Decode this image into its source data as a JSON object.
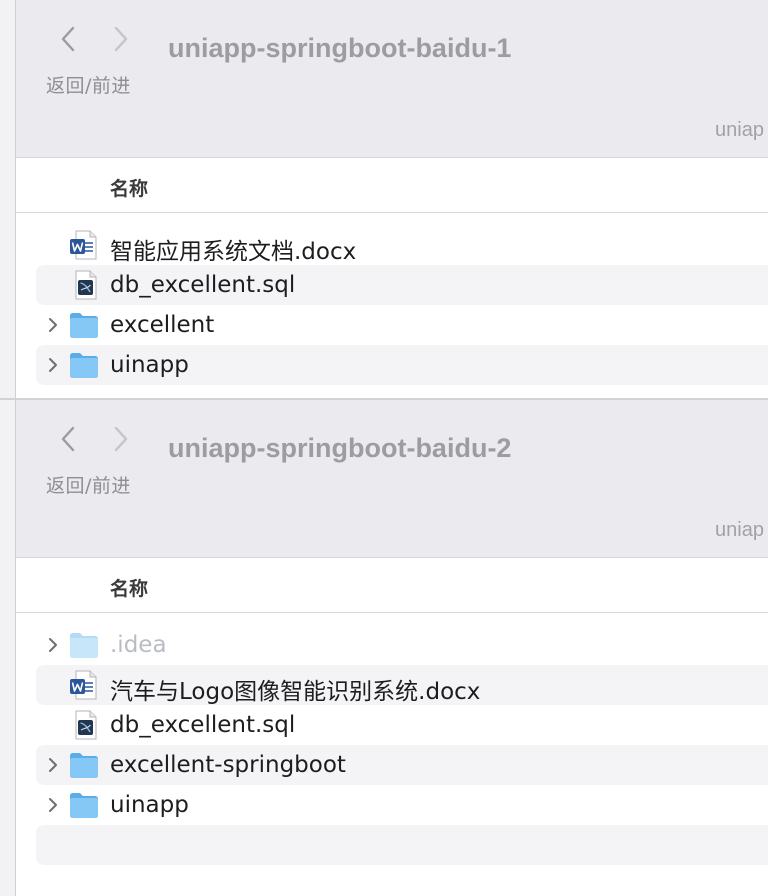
{
  "window1": {
    "title": "uniapp-springboot-baidu-1",
    "nav_caption": "返回/前进",
    "path_stub": "uniap",
    "column_header": "名称",
    "items": [
      {
        "name": "智能应用系统文档.docx",
        "icon": "word-doc-icon"
      },
      {
        "name": "db_excellent.sql",
        "icon": "sql-file-icon"
      },
      {
        "name": "excellent",
        "icon": "folder-icon"
      },
      {
        "name": "uinapp",
        "icon": "folder-icon"
      }
    ]
  },
  "window2": {
    "title": "uniapp-springboot-baidu-2",
    "nav_caption": "返回/前进",
    "path_stub": "uniap",
    "column_header": "名称",
    "items": [
      {
        "name": ".idea",
        "icon": "folder-icon"
      },
      {
        "name": "汽车与Logo图像智能识别系统.docx",
        "icon": "word-doc-icon"
      },
      {
        "name": "db_excellent.sql",
        "icon": "sql-file-icon"
      },
      {
        "name": "excellent-springboot",
        "icon": "folder-icon"
      },
      {
        "name": "uinapp",
        "icon": "folder-icon"
      }
    ]
  },
  "colors": {
    "toolbar_bg": "#ebeaef",
    "folder_blue": "#7cc0f2",
    "title_gray": "#9c9ca2",
    "row_stripe": "#f4f4f6"
  }
}
